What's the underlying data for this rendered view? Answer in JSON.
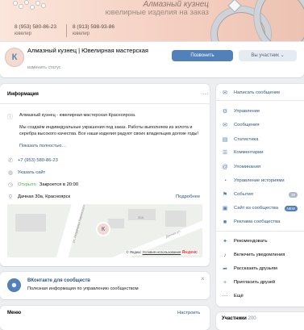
{
  "cover": {
    "title": "Алмазный кузнец",
    "subtitle": "ювелирные изделия на заказ",
    "phones": [
      {
        "number": "8 (953) 580-86-23",
        "label": "ювелир"
      },
      {
        "number": "8 (913) 598-93-86",
        "label": "ювелир"
      }
    ]
  },
  "header": {
    "name": "Алмазный кузнец | Ювелирная мастерская",
    "status_placeholder": "изменить статус",
    "btn_primary": "Позвонить",
    "btn_secondary": "Вы участник",
    "btn_secondary_arrow": "⌄",
    "avatar_letter": "К"
  },
  "info": {
    "title": "Информация",
    "summary": "Алмазный кузнец - ювелирная мастерская Красноярска.",
    "description": "Мы создаём индивидуальные украшения под заказ. Работы выполняем из золота и серебра высокого качества. Все наши изделия радуют своих владельцев долгие годы!",
    "more": "Показать полностью…",
    "phone": "+7 (953) 580-86-23",
    "site": "Указать сайт",
    "open": "Открыто",
    "closes": "Закроется в 20:00",
    "address": "Дачная 30а, Красноярск",
    "address_more": "Подробнее"
  },
  "map": {
    "labels": [
      "ул. Академика Киренского",
      "Дачная ул.",
      "30А"
    ],
    "attribution_prefix": "© Яндекс",
    "attribution": "Условия использования",
    "brand": "Яндекс"
  },
  "vk_card": {
    "title": "ВКонтакте для сообществ",
    "text": "Полезная информация по управлению сообществом",
    "close": "×"
  },
  "menu": {
    "title": "Меню",
    "action": "Настроить"
  },
  "sidebar": {
    "write": "Написать сообщение",
    "items": [
      {
        "label": "Управление",
        "icon": "gear-icon",
        "glyph": "⚙"
      },
      {
        "label": "Сообщения",
        "icon": "chat-icon",
        "glyph": "✉"
      },
      {
        "label": "Статистика",
        "icon": "chart-icon",
        "glyph": "▤"
      },
      {
        "label": "Комментарии",
        "icon": "comment-icon",
        "glyph": "☰"
      },
      {
        "label": "Упоминания",
        "icon": "at-icon",
        "glyph": "@"
      },
      {
        "label": "Управление историями",
        "icon": "stories-icon",
        "glyph": "◔"
      },
      {
        "label": "События",
        "icon": "events-icon",
        "glyph": "⚑",
        "badge": "28"
      },
      {
        "label": "Сайт из сообщества",
        "icon": "site-icon",
        "glyph": "▣",
        "badge": "NEW"
      },
      {
        "label": "Реклама сообщества",
        "icon": "ads-icon",
        "glyph": "■"
      }
    ],
    "extra": [
      {
        "label": "Рекомендовать",
        "icon": "recommend-icon",
        "glyph": "✦"
      },
      {
        "label": "Включить уведомления",
        "icon": "bell-icon",
        "glyph": "♪"
      },
      {
        "label": "Рассказать друзьям",
        "icon": "share-icon",
        "glyph": "➦"
      },
      {
        "label": "Пригласить друзей",
        "icon": "invite-icon",
        "glyph": "+"
      },
      {
        "label": "Ещё",
        "icon": "more-icon",
        "glyph": "⋯"
      }
    ],
    "members_label": "Участники",
    "members_count": "200"
  }
}
